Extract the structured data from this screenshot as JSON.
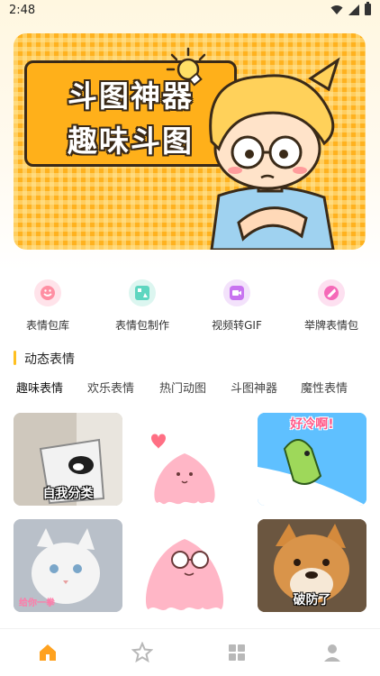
{
  "status_bar": {
    "time": "2:48",
    "icons": [
      "wifi-icon",
      "signal-icon",
      "battery-icon"
    ]
  },
  "banner": {
    "title_line1": "斗图神器",
    "title_line2": "趣味斗图",
    "icons": [
      "lightbulb-icon"
    ],
    "colors": {
      "background": "#ffb21f",
      "title_text": "#ffffff",
      "outline": "#3a2a18"
    }
  },
  "features": [
    {
      "label": "表情包库",
      "icon": "smile-icon",
      "color": "#ff8fa3",
      "bg": "#ffe3ea"
    },
    {
      "label": "表情包制作",
      "icon": "image-edit-icon",
      "color": "#5ed6c0",
      "bg": "#dcf6f0"
    },
    {
      "label": "视频转GIF",
      "icon": "video-icon",
      "color": "#c873f0",
      "bg": "#f3e2fb"
    },
    {
      "label": "举牌表情包",
      "icon": "sign-icon",
      "color": "#f569b8",
      "bg": "#fde0f0"
    }
  ],
  "section": {
    "title": "动态表情",
    "accent": "#ffc021"
  },
  "tabs": [
    {
      "label": "趣味表情",
      "active": true
    },
    {
      "label": "欢乐表情",
      "active": false
    },
    {
      "label": "热门动图",
      "active": false
    },
    {
      "label": "斗图神器",
      "active": false
    },
    {
      "label": "魔性表情",
      "active": false
    }
  ],
  "grid": [
    {
      "caption": "自我分类",
      "subject": "cat-in-trash-bin"
    },
    {
      "caption": "",
      "subject": "pink-ghost-with-heart"
    },
    {
      "caption": "好冷啊!",
      "subject": "green-cartoon-sliding"
    },
    {
      "caption": "给你一拳",
      "subject": "white-cat"
    },
    {
      "caption": "",
      "subject": "pink-ghost-with-glasses"
    },
    {
      "caption": "破防了",
      "subject": "shiba-dog"
    }
  ],
  "bottom_nav": [
    {
      "icon": "home-icon",
      "active": true,
      "color": "#ffa21f"
    },
    {
      "icon": "star-badge-icon",
      "active": false,
      "color": "#b8b8b8"
    },
    {
      "icon": "grid-icon",
      "active": false,
      "color": "#b8b8b8"
    },
    {
      "icon": "user-icon",
      "active": false,
      "color": "#b8b8b8"
    }
  ]
}
